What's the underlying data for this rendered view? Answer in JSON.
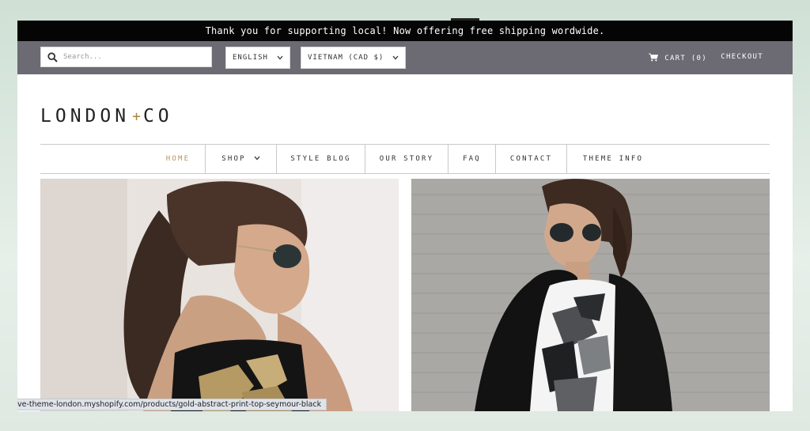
{
  "announcement": "Thank you for supporting local! Now offering free shipping wordwide.",
  "search": {
    "placeholder": "Search..."
  },
  "language": {
    "selected": "ENGLISH"
  },
  "country": {
    "selected": "VIETNAM (CAD $)"
  },
  "cart": {
    "label": "CART (0)",
    "icon": "cart-icon"
  },
  "checkout_label": "CHECKOUT",
  "logo": {
    "left": "LONDON",
    "plus": "+",
    "right": "CO"
  },
  "nav": {
    "items": [
      {
        "label": "HOME",
        "active": true
      },
      {
        "label": "SHOP",
        "has_dropdown": true
      },
      {
        "label": "STYLE BLOG"
      },
      {
        "label": "OUR STORY"
      },
      {
        "label": "FAQ"
      },
      {
        "label": "CONTACT"
      },
      {
        "label": "THEME INFO"
      }
    ]
  },
  "status_bar": {
    "url": "ve-theme-london.myshopify.com/products/gold-abstract-print-top-seymour-black"
  },
  "colors": {
    "announcement_bg": "#050505",
    "utility_bg": "#6c6a72",
    "accent_gold": "#b8955a",
    "text": "#333333"
  }
}
